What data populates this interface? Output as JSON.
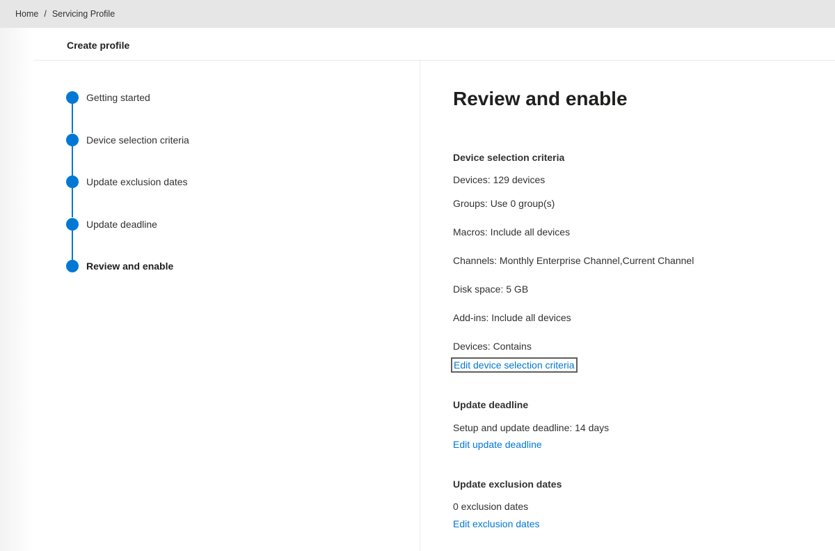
{
  "breadcrumb": {
    "items": [
      "Home",
      "Servicing Profile"
    ],
    "separator": "/"
  },
  "header": {
    "title": "Create profile"
  },
  "steps": [
    {
      "label": "Getting started",
      "current": false
    },
    {
      "label": "Device selection criteria",
      "current": false
    },
    {
      "label": "Update exclusion dates",
      "current": false
    },
    {
      "label": "Update deadline",
      "current": false
    },
    {
      "label": "Review and enable",
      "current": true
    }
  ],
  "main": {
    "heading": "Review and enable",
    "device_selection": {
      "title": "Device selection criteria",
      "lines": [
        "Devices: 129 devices",
        "Groups: Use 0 group(s)",
        "Macros: Include all devices",
        "Channels: Monthly Enterprise Channel,Current Channel",
        "Disk space: 5 GB",
        "Add-ins: Include all devices",
        "Devices: Contains"
      ],
      "edit_link": "Edit device selection criteria"
    },
    "update_deadline": {
      "title": "Update deadline",
      "line": "Setup and update deadline: 14 days",
      "edit_link": "Edit update deadline"
    },
    "update_exclusion": {
      "title": "Update exclusion dates",
      "line": "0 exclusion dates",
      "edit_link": "Edit exclusion dates"
    }
  },
  "colors": {
    "accent": "#0078d4",
    "topbar": "#e6e6e6",
    "text": "#323130"
  }
}
